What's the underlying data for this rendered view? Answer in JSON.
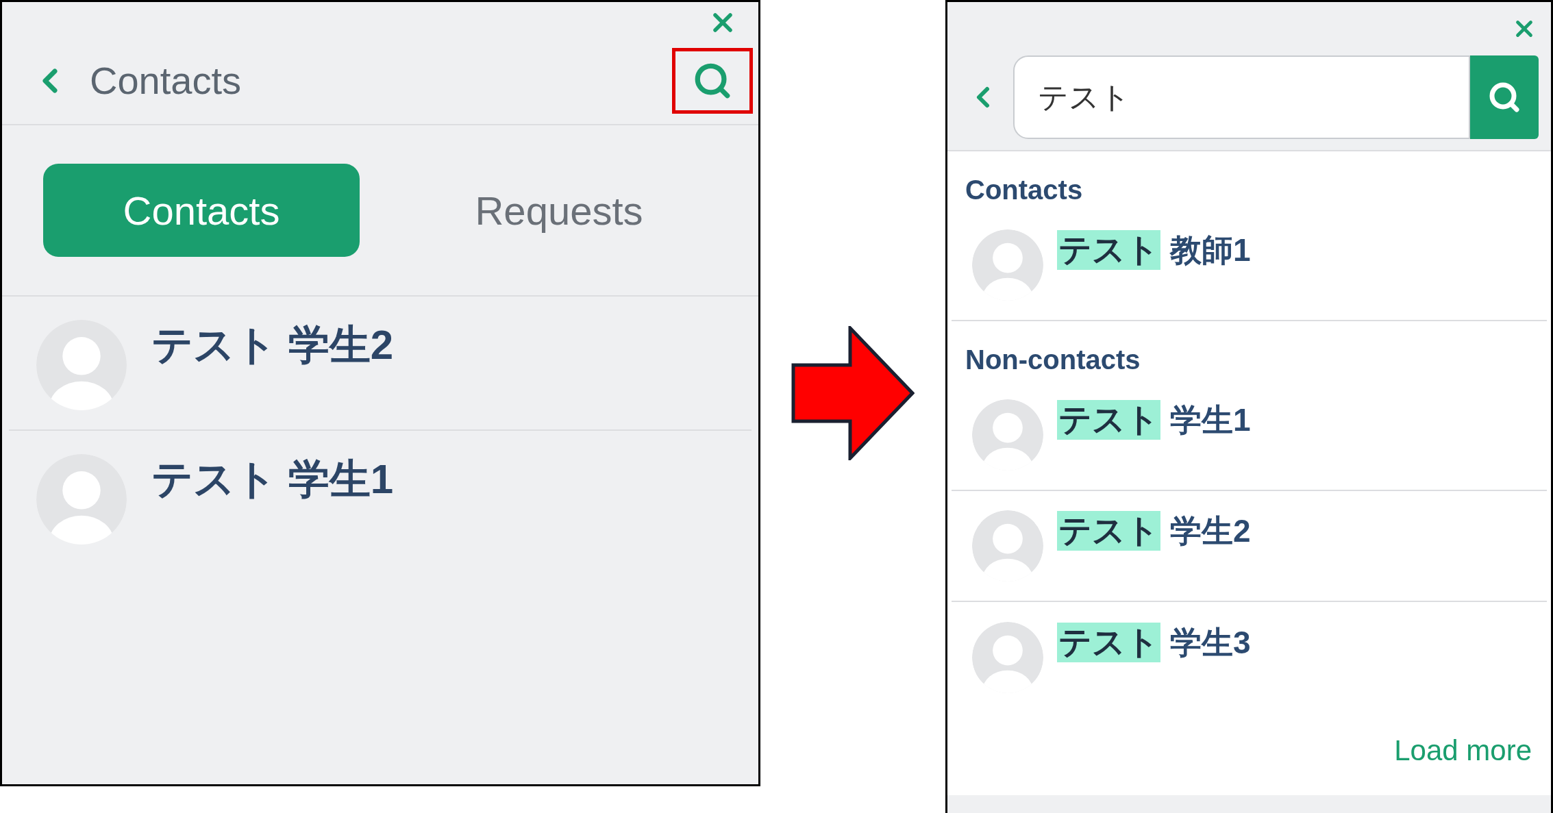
{
  "before": {
    "header": {
      "title": "Contacts",
      "search_highlighted": true
    },
    "tabs": [
      {
        "label": "Contacts",
        "selected": true
      },
      {
        "label": "Requests",
        "selected": false
      }
    ],
    "contacts": [
      {
        "name": "テスト 学生2"
      },
      {
        "name": "テスト 学生1"
      }
    ]
  },
  "after": {
    "search": {
      "value": "テスト"
    },
    "sections": [
      {
        "heading": "Contacts",
        "results": [
          {
            "match": "テスト",
            "rest": "教師1"
          }
        ]
      },
      {
        "heading": "Non-contacts",
        "results": [
          {
            "match": "テスト",
            "rest": "学生1"
          },
          {
            "match": "テスト",
            "rest": "学生2"
          },
          {
            "match": "テスト",
            "rest": "学生3"
          }
        ]
      }
    ],
    "load_more": "Load more"
  }
}
